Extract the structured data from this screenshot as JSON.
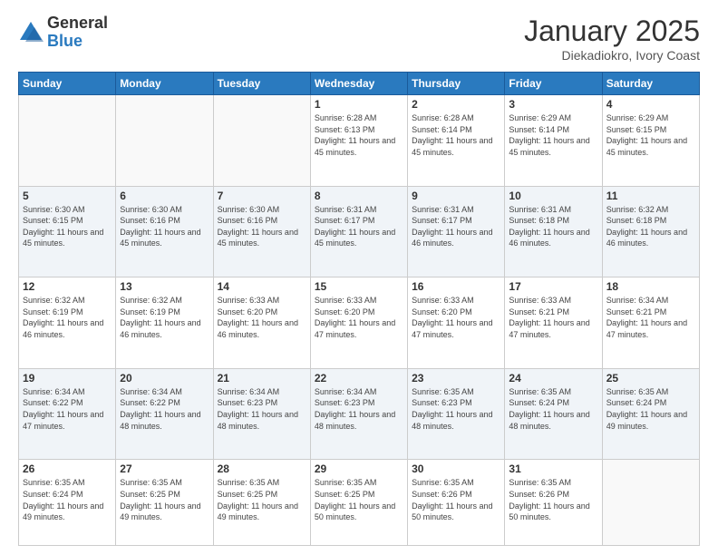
{
  "logo": {
    "general": "General",
    "blue": "Blue"
  },
  "header": {
    "month": "January 2025",
    "location": "Diekadiokro, Ivory Coast"
  },
  "weekdays": [
    "Sunday",
    "Monday",
    "Tuesday",
    "Wednesday",
    "Thursday",
    "Friday",
    "Saturday"
  ],
  "weeks": [
    [
      {
        "day": "",
        "empty": true
      },
      {
        "day": "",
        "empty": true
      },
      {
        "day": "",
        "empty": true
      },
      {
        "day": "1",
        "sunrise": "6:28 AM",
        "sunset": "6:13 PM",
        "daylight": "11 hours and 45 minutes."
      },
      {
        "day": "2",
        "sunrise": "6:28 AM",
        "sunset": "6:14 PM",
        "daylight": "11 hours and 45 minutes."
      },
      {
        "day": "3",
        "sunrise": "6:29 AM",
        "sunset": "6:14 PM",
        "daylight": "11 hours and 45 minutes."
      },
      {
        "day": "4",
        "sunrise": "6:29 AM",
        "sunset": "6:15 PM",
        "daylight": "11 hours and 45 minutes."
      }
    ],
    [
      {
        "day": "5",
        "sunrise": "6:30 AM",
        "sunset": "6:15 PM",
        "daylight": "11 hours and 45 minutes."
      },
      {
        "day": "6",
        "sunrise": "6:30 AM",
        "sunset": "6:16 PM",
        "daylight": "11 hours and 45 minutes."
      },
      {
        "day": "7",
        "sunrise": "6:30 AM",
        "sunset": "6:16 PM",
        "daylight": "11 hours and 45 minutes."
      },
      {
        "day": "8",
        "sunrise": "6:31 AM",
        "sunset": "6:17 PM",
        "daylight": "11 hours and 45 minutes."
      },
      {
        "day": "9",
        "sunrise": "6:31 AM",
        "sunset": "6:17 PM",
        "daylight": "11 hours and 46 minutes."
      },
      {
        "day": "10",
        "sunrise": "6:31 AM",
        "sunset": "6:18 PM",
        "daylight": "11 hours and 46 minutes."
      },
      {
        "day": "11",
        "sunrise": "6:32 AM",
        "sunset": "6:18 PM",
        "daylight": "11 hours and 46 minutes."
      }
    ],
    [
      {
        "day": "12",
        "sunrise": "6:32 AM",
        "sunset": "6:19 PM",
        "daylight": "11 hours and 46 minutes."
      },
      {
        "day": "13",
        "sunrise": "6:32 AM",
        "sunset": "6:19 PM",
        "daylight": "11 hours and 46 minutes."
      },
      {
        "day": "14",
        "sunrise": "6:33 AM",
        "sunset": "6:20 PM",
        "daylight": "11 hours and 46 minutes."
      },
      {
        "day": "15",
        "sunrise": "6:33 AM",
        "sunset": "6:20 PM",
        "daylight": "11 hours and 47 minutes."
      },
      {
        "day": "16",
        "sunrise": "6:33 AM",
        "sunset": "6:20 PM",
        "daylight": "11 hours and 47 minutes."
      },
      {
        "day": "17",
        "sunrise": "6:33 AM",
        "sunset": "6:21 PM",
        "daylight": "11 hours and 47 minutes."
      },
      {
        "day": "18",
        "sunrise": "6:34 AM",
        "sunset": "6:21 PM",
        "daylight": "11 hours and 47 minutes."
      }
    ],
    [
      {
        "day": "19",
        "sunrise": "6:34 AM",
        "sunset": "6:22 PM",
        "daylight": "11 hours and 47 minutes."
      },
      {
        "day": "20",
        "sunrise": "6:34 AM",
        "sunset": "6:22 PM",
        "daylight": "11 hours and 48 minutes."
      },
      {
        "day": "21",
        "sunrise": "6:34 AM",
        "sunset": "6:23 PM",
        "daylight": "11 hours and 48 minutes."
      },
      {
        "day": "22",
        "sunrise": "6:34 AM",
        "sunset": "6:23 PM",
        "daylight": "11 hours and 48 minutes."
      },
      {
        "day": "23",
        "sunrise": "6:35 AM",
        "sunset": "6:23 PM",
        "daylight": "11 hours and 48 minutes."
      },
      {
        "day": "24",
        "sunrise": "6:35 AM",
        "sunset": "6:24 PM",
        "daylight": "11 hours and 48 minutes."
      },
      {
        "day": "25",
        "sunrise": "6:35 AM",
        "sunset": "6:24 PM",
        "daylight": "11 hours and 49 minutes."
      }
    ],
    [
      {
        "day": "26",
        "sunrise": "6:35 AM",
        "sunset": "6:24 PM",
        "daylight": "11 hours and 49 minutes."
      },
      {
        "day": "27",
        "sunrise": "6:35 AM",
        "sunset": "6:25 PM",
        "daylight": "11 hours and 49 minutes."
      },
      {
        "day": "28",
        "sunrise": "6:35 AM",
        "sunset": "6:25 PM",
        "daylight": "11 hours and 49 minutes."
      },
      {
        "day": "29",
        "sunrise": "6:35 AM",
        "sunset": "6:25 PM",
        "daylight": "11 hours and 50 minutes."
      },
      {
        "day": "30",
        "sunrise": "6:35 AM",
        "sunset": "6:26 PM",
        "daylight": "11 hours and 50 minutes."
      },
      {
        "day": "31",
        "sunrise": "6:35 AM",
        "sunset": "6:26 PM",
        "daylight": "11 hours and 50 minutes."
      },
      {
        "day": "",
        "empty": true
      }
    ]
  ]
}
